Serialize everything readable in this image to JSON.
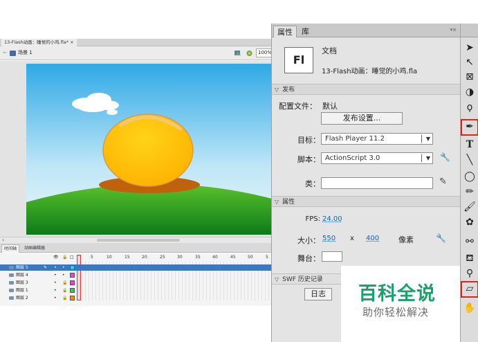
{
  "document_tab": "13-Flash动画：睡觉的小鸡.fla* ×",
  "edit_bar": {
    "scene": "场景 1",
    "zoom": "100%"
  },
  "timeline": {
    "tabs": [
      "时间轴",
      "动画编辑器"
    ],
    "frame_numbers": [
      "1",
      "5",
      "10",
      "15",
      "20",
      "25",
      "30",
      "35",
      "40",
      "45",
      "50",
      "5"
    ],
    "layers": [
      {
        "name": "图层 5",
        "color": "#37c6e8",
        "selected": true
      },
      {
        "name": "图层 4",
        "color": "#e04ad6",
        "selected": false
      },
      {
        "name": "图层 3",
        "color": "#d84bc8",
        "selected": false
      },
      {
        "name": "图层 1",
        "color": "#35c45a",
        "selected": false
      },
      {
        "name": "图层 2",
        "color": "#f08a1e",
        "selected": false
      }
    ]
  },
  "panel": {
    "tabs": [
      "属性",
      "库"
    ],
    "doc_icon": "Fl",
    "doc_type": "文档",
    "doc_name": "13-Flash动画：睡觉的小鸡.fla",
    "publish_section": "发布",
    "profile_label": "配置文件：",
    "profile_value": "默认",
    "publish_settings_button": "发布设置...",
    "target_label": "目标：",
    "target_value": "Flash Player 11.2",
    "script_label": "脚本：",
    "script_value": "ActionScript 3.0",
    "class_label": "类：",
    "properties_section": "属性",
    "fps_label": "FPS:",
    "fps_value": "24.00",
    "size_label": "大小：",
    "width": "550",
    "x_sep": "x",
    "height": "400",
    "unit": "像素",
    "stage_label": "舞台：",
    "swf_history_section": "SWF 历史记录",
    "log_button": "日志"
  },
  "watermark": {
    "title": "百科全说",
    "subtitle": "助你轻松解决"
  },
  "tools": [
    "selection-arrow-icon",
    "subselection-icon",
    "free-transform-icon",
    "3d-rotation-icon",
    "lasso-icon",
    "pen-icon",
    "text-icon",
    "line-icon",
    "oval-icon",
    "pencil-icon",
    "brush-icon",
    "deco-icon",
    "bone-icon",
    "paint-bucket-icon",
    "eyedropper-icon",
    "eraser-icon",
    "hand-icon"
  ],
  "colors": {
    "highlight": "#e0201a",
    "link": "#1f5fb0",
    "watermark": "#1aa06a"
  }
}
